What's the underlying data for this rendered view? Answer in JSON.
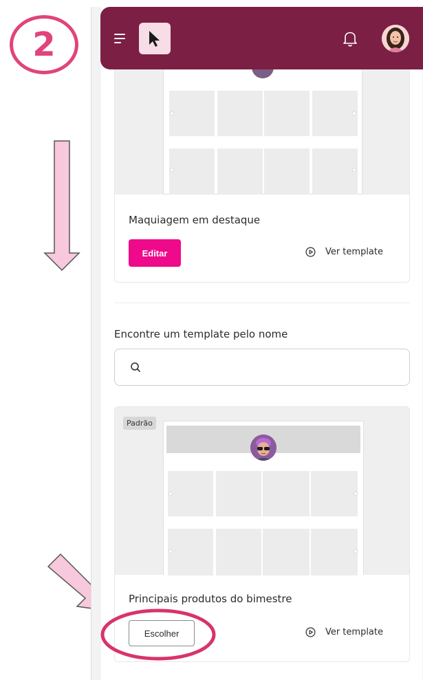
{
  "annotation": {
    "step_number": "2",
    "accent_color": "#e0447c",
    "arrow_fill": "#f8c8dd"
  },
  "topbar": {
    "background": "#7b1f45",
    "menu_icon": "hamburger-icon",
    "logo_icon": "cursor-arrow-icon",
    "bell_icon": "bell-icon"
  },
  "cards": [
    {
      "title": "Maquiagem em destaque",
      "button_label": "Editar",
      "view_label": "Ver template"
    },
    {
      "badge": "Padrão",
      "title": "Principais produtos do bimestre",
      "button_label": "Escolher",
      "view_label": "Ver template"
    }
  ],
  "search": {
    "label": "Encontre um template pelo nome",
    "value": "",
    "placeholder": ""
  },
  "colors": {
    "primary_button": "#ee0a8b",
    "text": "#2b2b2b"
  }
}
